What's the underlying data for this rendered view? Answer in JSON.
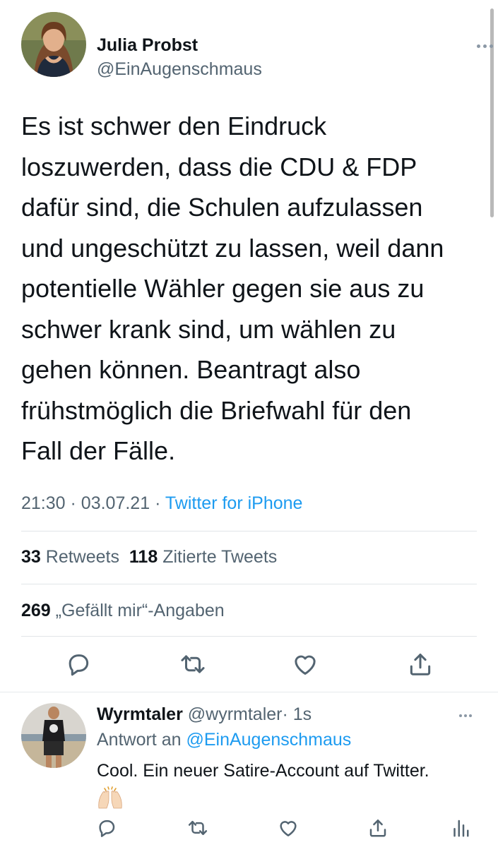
{
  "tweet": {
    "author_name": "Julia Probst",
    "author_handle": "@EinAugenschmaus",
    "text_lines": [
      "Es ist schwer den Eindruck",
      "loszuwerden, dass die CDU & FDP",
      "dafür sind, die Schulen aufzulassen",
      "und ungeschützt zu lassen, weil dann",
      "potentielle Wähler gegen sie aus zu",
      "schwer krank sind, um wählen zu",
      "gehen können. Beantragt also",
      "frühstmöglich die Briefwahl für den",
      "Fall der Fälle."
    ],
    "time": "21:30",
    "dot1": "·",
    "date": "03.07.21",
    "dot2": "·",
    "source": "Twitter for iPhone",
    "retweets_count": "33",
    "retweets_label": "Retweets",
    "quotes_count": "118",
    "quotes_label": "Zitierte Tweets",
    "likes_count": "269",
    "likes_label": "„Gefällt mir“-Angaben"
  },
  "actions": {
    "reply_icon": "reply-icon",
    "retweet_icon": "retweet-icon",
    "like_icon": "like-icon",
    "share_icon": "share-icon"
  },
  "reply": {
    "name": "Wyrmtaler",
    "handle": "@wyrmtaler",
    "dot": "·",
    "time": "1s",
    "reply_to_label": "Antwort an",
    "reply_to_handle": "@EinAugenschmaus",
    "text": "Cool. Ein neuer Satire-Account auf Twitter.",
    "emoji": "raising-hands-emoji"
  },
  "colors": {
    "text": "#0f1419",
    "secondary": "#536471",
    "link": "#1d9bf0",
    "divider": "#e1e5e8"
  }
}
